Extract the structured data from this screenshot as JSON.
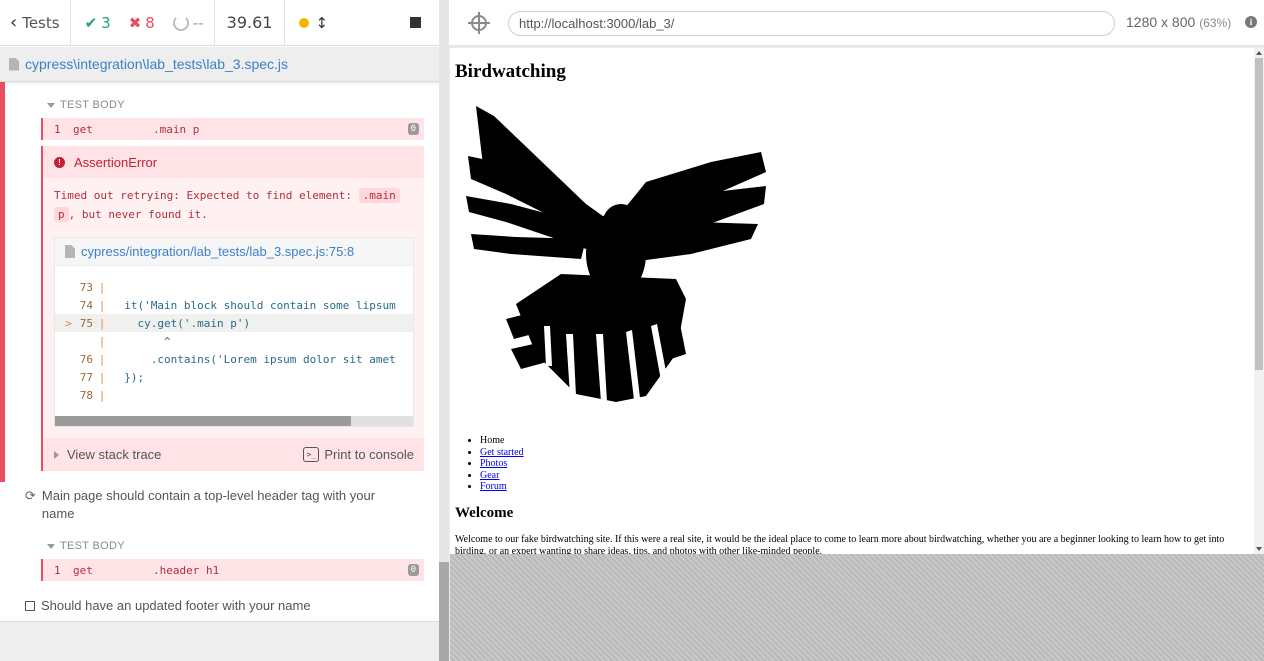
{
  "reporter": {
    "tests_label": "Tests",
    "passed": "3",
    "failed": "8",
    "pending": "--",
    "duration": "39.61",
    "spec_path": "cypress\\integration\\lab_tests\\lab_3.spec.js",
    "first_test": {
      "section": "TEST BODY",
      "command": {
        "num": "1",
        "name": "get",
        "message": ".main p",
        "badge": "0"
      },
      "error": {
        "title": "AssertionError",
        "msg_pre": "Timed out retrying: Expected to find element: ",
        "msg_code_1": ".main",
        "msg_code_2": "p",
        "msg_post": ", but never found it.",
        "frame_path": "cypress/integration/lab_tests/lab_3.spec.js:75:8",
        "code_lines": [
          {
            "arrow": "",
            "ln": "73",
            "pipe": "|",
            "src": ""
          },
          {
            "arrow": "",
            "ln": "74",
            "pipe": "|",
            "src": "  it('Main block should contain some lipsum"
          },
          {
            "arrow": ">",
            "ln": "75",
            "pipe": "|",
            "src": "    cy.get('.main p')"
          },
          {
            "arrow": "",
            "ln": "",
            "pipe": "|",
            "src": "        ^"
          },
          {
            "arrow": "",
            "ln": "76",
            "pipe": "|",
            "src": "      .contains('Lorem ipsum dolor sit amet"
          },
          {
            "arrow": "",
            "ln": "77",
            "pipe": "|",
            "src": "  });"
          },
          {
            "arrow": "",
            "ln": "78",
            "pipe": "|",
            "src": ""
          }
        ],
        "stack_label": "View stack trace",
        "print_label": "Print to console"
      }
    },
    "second_test": {
      "title": "Main page should contain a top-level header tag with your name",
      "section": "TEST BODY",
      "command": {
        "num": "1",
        "name": "get",
        "message": ".header h1",
        "badge": "0"
      }
    },
    "third_test": {
      "title": "Should have an updated footer with your name"
    }
  },
  "aut": {
    "url": "http://localhost:3000/lab_3/",
    "viewport": "1280 x 800",
    "scale": "(63%)",
    "page": {
      "heading": "Birdwatching",
      "nav": [
        "Home",
        "Get started",
        "Photos",
        "Gear",
        "Forum"
      ],
      "section_heading": "Welcome",
      "intro": "Welcome to our fake birdwatching site. If this were a real site, it would be the ideal place to come to learn more about birdwatching, whether you are a beginner looking to learn how to get into birding, or an expert wanting to share ideas, tips, and photos with other like-minded people."
    }
  },
  "colors": {
    "pass": "#24a37a",
    "fail": "#e94f5f",
    "link": "#3c80c9"
  },
  "icons": [
    "chevron-left-icon",
    "check-icon",
    "x-icon",
    "pending-ring-icon",
    "status-dot-icon",
    "up-down-arrows-icon",
    "stop-icon",
    "file-icon",
    "alert-icon",
    "caret-down-icon",
    "caret-right-icon",
    "terminal-icon",
    "retry-icon",
    "checkbox-icon",
    "crosshair-icon",
    "info-icon"
  ]
}
